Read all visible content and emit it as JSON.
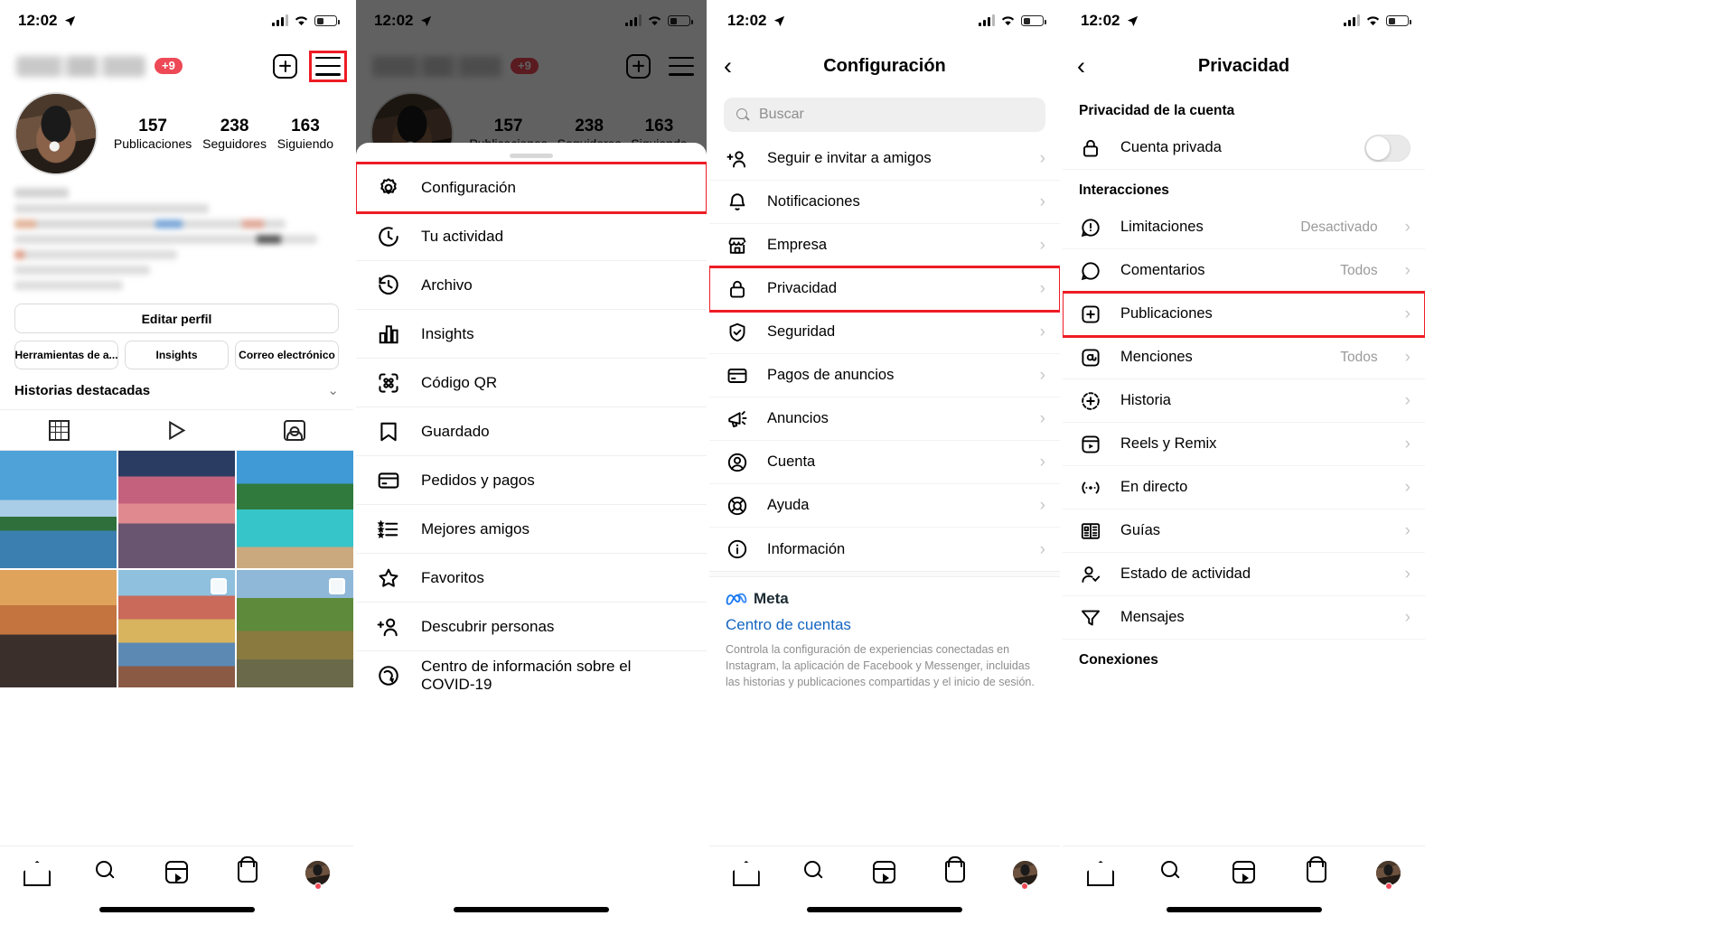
{
  "status_bar": {
    "time": "12:02",
    "location_icon": "location-arrow-icon",
    "signal_icon": "cellular-bars-icon",
    "wifi_icon": "wifi-icon",
    "battery_icon": "battery-icon"
  },
  "screen1_profile": {
    "name": "profile-screen",
    "username_badge": "+9",
    "add_icon": "plus-box-icon",
    "menu_icon": "hamburger-menu-icon",
    "avatar": "profile-avatar",
    "stats": [
      {
        "num": "157",
        "label": "Publicaciones"
      },
      {
        "num": "238",
        "label": "Seguidores"
      },
      {
        "num": "163",
        "label": "Siguiendo"
      }
    ],
    "edit_profile_label": "Editar perfil",
    "secondary_buttons": [
      "Herramientas de a...",
      "Insights",
      "Correo electrónico"
    ],
    "highlights_label": "Historias destacadas",
    "highlights_chevron": "chevron-down-icon",
    "content_tabs": [
      "grid-tab-icon",
      "reels-tab-icon",
      "tagged-tab-icon"
    ]
  },
  "screen2_drawer": {
    "name": "menu-drawer-screen",
    "username_badge": "+9",
    "items": [
      {
        "label": "Configuración",
        "icon": "gear-icon",
        "highlighted": true
      },
      {
        "label": "Tu actividad",
        "icon": "activity-clock-icon",
        "highlighted": false
      },
      {
        "label": "Archivo",
        "icon": "archive-clock-icon",
        "highlighted": false
      },
      {
        "label": "Insights",
        "icon": "bar-chart-icon",
        "highlighted": false
      },
      {
        "label": "Código QR",
        "icon": "qr-code-icon",
        "highlighted": false
      },
      {
        "label": "Guardado",
        "icon": "bookmark-icon",
        "highlighted": false
      },
      {
        "label": "Pedidos y pagos",
        "icon": "credit-card-icon",
        "highlighted": false
      },
      {
        "label": "Mejores amigos",
        "icon": "close-friends-list-icon",
        "highlighted": false
      },
      {
        "label": "Favoritos",
        "icon": "star-icon",
        "highlighted": false
      },
      {
        "label": "Descubrir personas",
        "icon": "add-person-icon",
        "highlighted": false
      },
      {
        "label": "Centro de información sobre el COVID-19",
        "icon": "covid-info-icon",
        "highlighted": false
      }
    ]
  },
  "screen3_settings": {
    "name": "settings-screen",
    "title": "Configuración",
    "back_icon": "chevron-left-icon",
    "search_placeholder": "Buscar",
    "search_icon": "search-icon",
    "items": [
      {
        "label": "Seguir e invitar a amigos",
        "icon": "add-person-icon",
        "highlighted": false
      },
      {
        "label": "Notificaciones",
        "icon": "bell-icon",
        "highlighted": false
      },
      {
        "label": "Empresa",
        "icon": "storefront-icon",
        "highlighted": false
      },
      {
        "label": "Privacidad",
        "icon": "lock-icon",
        "highlighted": true
      },
      {
        "label": "Seguridad",
        "icon": "shield-check-icon",
        "highlighted": false
      },
      {
        "label": "Pagos de anuncios",
        "icon": "credit-card-icon",
        "highlighted": false
      },
      {
        "label": "Anuncios",
        "icon": "megaphone-icon",
        "highlighted": false
      },
      {
        "label": "Cuenta",
        "icon": "user-circle-icon",
        "highlighted": false
      },
      {
        "label": "Ayuda",
        "icon": "lifebuoy-icon",
        "highlighted": false
      },
      {
        "label": "Información",
        "icon": "info-circle-icon",
        "highlighted": false
      }
    ],
    "meta_logo_label": "Meta",
    "accounts_center_label": "Centro de cuentas",
    "meta_description": "Controla la configuración de experiencias conectadas en Instagram, la aplicación de Facebook y Messenger, incluidas las historias y publicaciones compartidas y el inicio de sesión."
  },
  "screen4_privacy": {
    "name": "privacy-screen",
    "title": "Privacidad",
    "back_icon": "chevron-left-icon",
    "section_account": "Privacidad de la cuenta",
    "private_account": {
      "label": "Cuenta privada",
      "icon": "lock-icon",
      "toggle_state": "off"
    },
    "section_interactions": "Interacciones",
    "interactions": [
      {
        "label": "Limitaciones",
        "icon": "limit-bubble-icon",
        "value": "Desactivado",
        "highlighted": false
      },
      {
        "label": "Comentarios",
        "icon": "comment-bubble-icon",
        "value": "Todos",
        "highlighted": false
      },
      {
        "label": "Publicaciones",
        "icon": "plus-box-icon",
        "value": "",
        "highlighted": true
      },
      {
        "label": "Menciones",
        "icon": "at-mention-icon",
        "value": "Todos",
        "highlighted": false
      },
      {
        "label": "Historia",
        "icon": "story-plus-icon",
        "value": "",
        "highlighted": false
      },
      {
        "label": "Reels y Remix",
        "icon": "reels-icon",
        "value": "",
        "highlighted": false
      },
      {
        "label": "En directo",
        "icon": "live-broadcast-icon",
        "value": "",
        "highlighted": false
      },
      {
        "label": "Guías",
        "icon": "guides-book-icon",
        "value": "",
        "highlighted": false
      },
      {
        "label": "Estado de actividad",
        "icon": "activity-status-icon",
        "value": "",
        "highlighted": false
      },
      {
        "label": "Mensajes",
        "icon": "messages-filter-icon",
        "value": "",
        "highlighted": false
      }
    ],
    "section_connections": "Conexiones"
  },
  "bottom_nav": {
    "items": [
      "home-icon",
      "search-icon",
      "reels-icon",
      "shop-icon",
      "profile-avatar-icon"
    ]
  },
  "colors": {
    "accent_red": "#ED4956",
    "highlight_red": "#EE1C25",
    "link_blue": "#1565C0",
    "muted": "#8e8e8e"
  }
}
